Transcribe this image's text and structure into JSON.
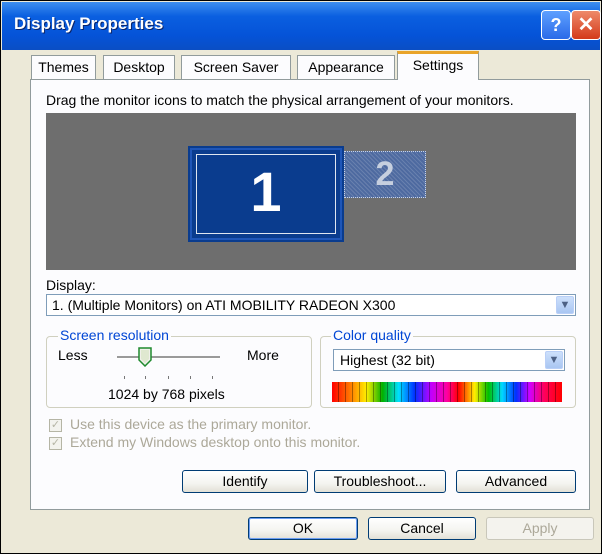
{
  "window": {
    "title": "Display Properties",
    "help_glyph": "?",
    "close_glyph": "✕"
  },
  "tabs": [
    {
      "label": "Themes"
    },
    {
      "label": "Desktop"
    },
    {
      "label": "Screen Saver"
    },
    {
      "label": "Appearance"
    },
    {
      "label": "Settings",
      "active": true
    }
  ],
  "settings": {
    "instructions": "Drag the monitor icons to match the physical arrangement of your monitors.",
    "monitors": [
      {
        "number": "1",
        "selected": true
      },
      {
        "number": "2",
        "selected": false
      }
    ],
    "display_label": "Display:",
    "display_value": "1. (Multiple Monitors) on ATI MOBILITY RADEON X300",
    "screen_resolution": {
      "legend": "Screen resolution",
      "less_label": "Less",
      "more_label": "More",
      "value_text": "1024 by 768 pixels",
      "slider_position": 0.2
    },
    "color_quality": {
      "legend": "Color quality",
      "value": "Highest (32 bit)"
    },
    "primary_monitor_checkbox": {
      "label": "Use this device as the primary monitor.",
      "checked": true,
      "enabled": false
    },
    "extend_desktop_checkbox": {
      "label": "Extend my Windows desktop onto this monitor.",
      "checked": true,
      "enabled": false
    },
    "identify_label": "Identify",
    "troubleshoot_label": "Troubleshoot...",
    "advanced_label": "Advanced"
  },
  "footer": {
    "ok_label": "OK",
    "cancel_label": "Cancel",
    "apply_label": "Apply",
    "apply_enabled": false
  },
  "colors": {
    "titlebar": "#0553d8",
    "active_tab_accent": "#e9a42a",
    "monitor_area": "#6e6e6e",
    "selected_monitor": "#0a3c8e",
    "group_legend": "#0046d5"
  },
  "icons": {
    "help": "help-icon",
    "close": "close-icon",
    "dropdown": "chevron-down-icon",
    "slider_thumb": "slider-thumb-icon",
    "checkbox": "checkmark-icon"
  }
}
